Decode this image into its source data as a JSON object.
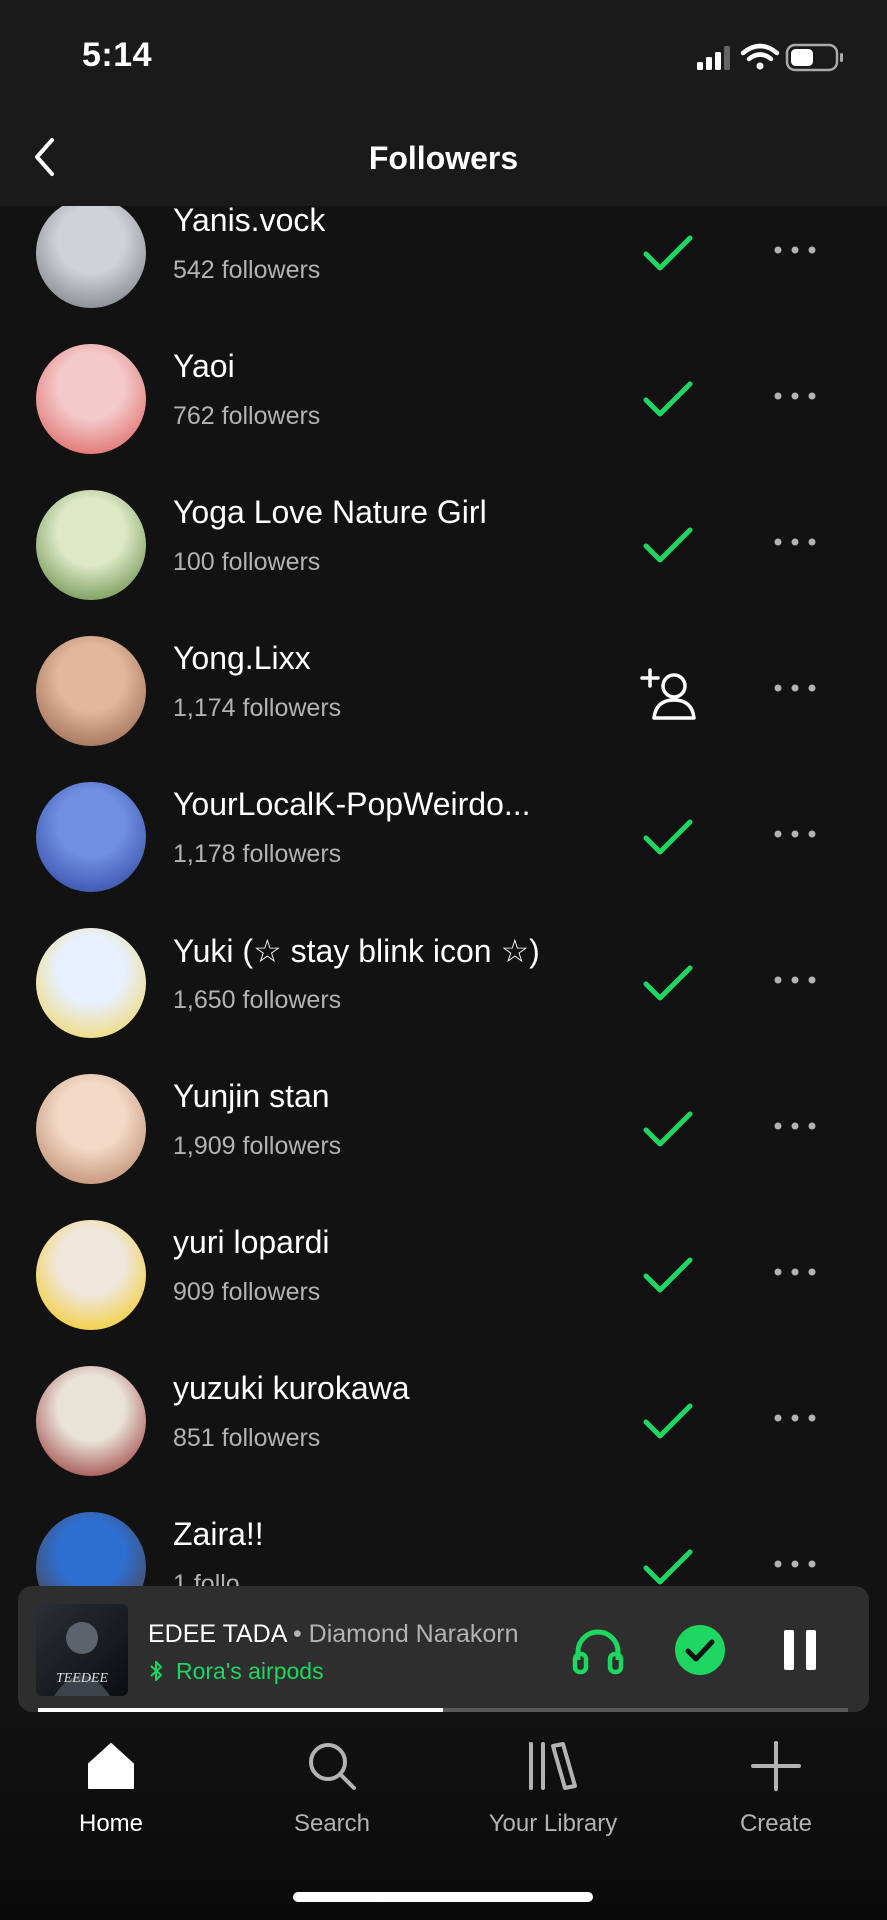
{
  "status_bar": {
    "time": "5:14"
  },
  "header": {
    "title": "Followers"
  },
  "followers": [
    {
      "name": "Yanis.vock",
      "followers": "542 followers",
      "following": true,
      "avatar_colors": [
        "#cfd3d8",
        "#6b7078"
      ]
    },
    {
      "name": "Yaoi",
      "followers": "762 followers",
      "following": true,
      "avatar_colors": [
        "#f3c9c9",
        "#d9534f"
      ]
    },
    {
      "name": "Yoga Love Nature Girl",
      "followers": "100 followers",
      "following": true,
      "avatar_colors": [
        "#dfe9c8",
        "#4f7d2f"
      ]
    },
    {
      "name": "Yong.Lixx",
      "followers": "1,174 followers",
      "following": false,
      "avatar_colors": [
        "#e2b79b",
        "#8a5a44"
      ]
    },
    {
      "name": "YourLocalK-PopWeirdo...",
      "followers": "1,178 followers",
      "following": true,
      "avatar_colors": [
        "#6f8fe0",
        "#2a3f9a"
      ]
    },
    {
      "name": "Yuki (☆ stay blink icon ☆)",
      "followers": "1,650 followers",
      "following": true,
      "avatar_colors": [
        "#e8f0ff",
        "#f2d34c"
      ]
    },
    {
      "name": "Yunjin stan",
      "followers": "1,909 followers",
      "following": true,
      "avatar_colors": [
        "#f3d9c6",
        "#b07a5c"
      ]
    },
    {
      "name": "yuri lopardi",
      "followers": "909 followers",
      "following": true,
      "avatar_colors": [
        "#efe7dc",
        "#f5c400"
      ]
    },
    {
      "name": "yuzuki kurokawa",
      "followers": "851 followers",
      "following": true,
      "avatar_colors": [
        "#e9e2d6",
        "#8b1e1e"
      ]
    },
    {
      "name": "Zaira!!",
      "followers": "1 follo",
      "following": true,
      "avatar_colors": [
        "#2d6fd0",
        "#5a3a2a"
      ]
    }
  ],
  "now_playing": {
    "song": "EDEE TADA",
    "separator": " • ",
    "artist": "Diamond Narakorn",
    "device": "Rora's airpods",
    "progress": 0.5
  },
  "tabs": [
    {
      "label": "Home",
      "icon": "home-icon",
      "active": true
    },
    {
      "label": "Search",
      "icon": "search-icon",
      "active": false
    },
    {
      "label": "Your Library",
      "icon": "library-icon",
      "active": false
    },
    {
      "label": "Create",
      "icon": "plus-icon",
      "active": false
    }
  ],
  "colors": {
    "accent": "#1ed760",
    "background": "#121212"
  }
}
